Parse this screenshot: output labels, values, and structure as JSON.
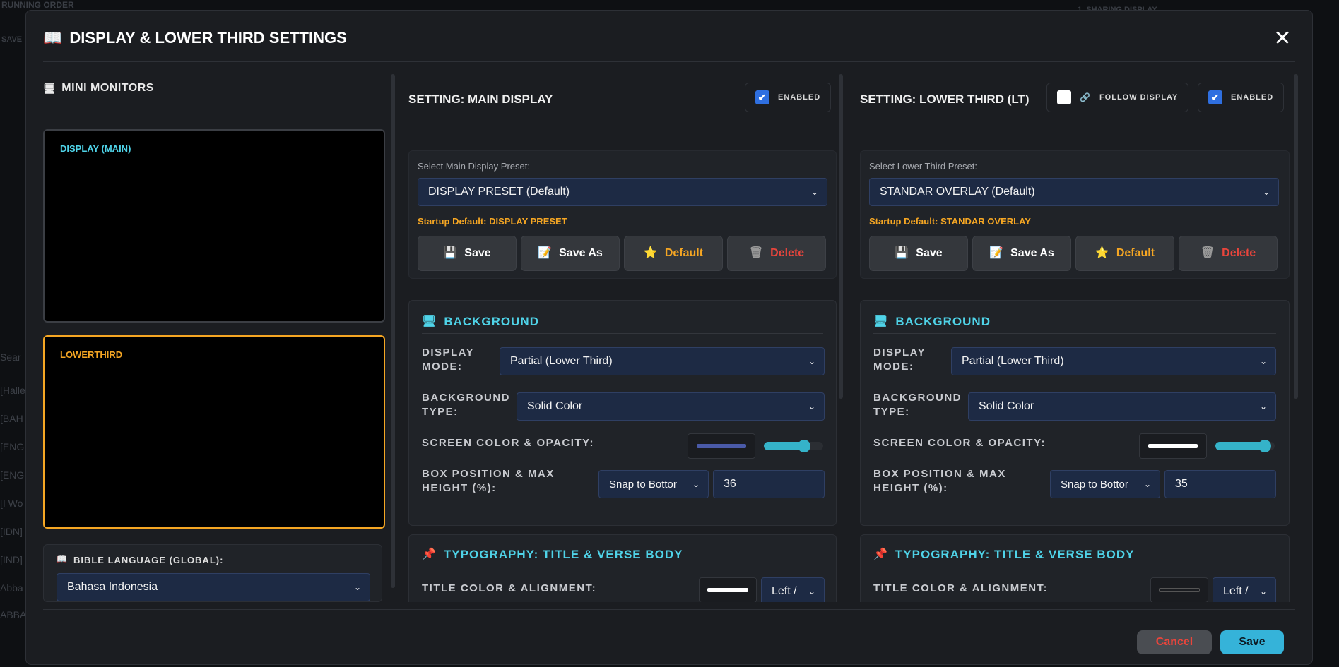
{
  "background": {
    "top_label": "RUNNING ORDER",
    "save_label": "SAVE",
    "right_label": "1. SHARING DISPLAY",
    "search_placeholder": "Sear",
    "list": [
      "[Halle",
      "[BAH",
      "[ENG",
      "[ENG",
      "[I Wo",
      "[IDN]",
      "[IND]",
      "Abba",
      "ABBA"
    ]
  },
  "modal": {
    "title": "DISPLAY & LOWER THIRD SETTINGS",
    "title_icon": "book-icon",
    "close_symbol": "✕"
  },
  "mini_monitors": {
    "title": "MINI MONITORS",
    "monitor_main_label": "DISPLAY (MAIN)",
    "monitor_lt_label": "LOWERTHIRD",
    "colors": {
      "main": "#4fd3e8",
      "lowerthird": "#f5a623"
    }
  },
  "bible_language": {
    "label": "BIBLE LANGUAGE (GLOBAL):",
    "value": "Bahasa Indonesia"
  },
  "main_panel": {
    "title": "SETTING: MAIN DISPLAY",
    "enabled_label": "ENABLED",
    "enabled": true,
    "preset_label": "Select Main Display Preset:",
    "preset_value": "DISPLAY PRESET (Default)",
    "startup_default": "Startup Default: DISPLAY PRESET",
    "buttons": {
      "save": "Save",
      "save_as": "Save As",
      "default": "Default",
      "delete": "Delete"
    },
    "background": {
      "title": "BACKGROUND",
      "display_mode_label": "DISPLAY MODE:",
      "display_mode_value": "Partial (Lower Third)",
      "bg_type_label": "BACKGROUND TYPE:",
      "bg_type_value": "Solid Color",
      "screen_color_label": "SCREEN COLOR & OPACITY:",
      "screen_color": "#4a5aa8",
      "opacity": 0.72,
      "box_position_label": "BOX POSITION & MAX HEIGHT (%):",
      "box_position_value": "Snap to Bottor",
      "max_height": "36"
    },
    "typography": {
      "title": "TYPOGRAPHY: TITLE & VERSE BODY",
      "title_color_label": "TITLE COLOR & ALIGNMENT:",
      "title_color": "#ffffff",
      "alignment_value": "Left /"
    }
  },
  "lt_panel": {
    "title": "SETTING: LOWER THIRD (LT)",
    "follow_label": "FOLLOW DISPLAY",
    "follow": false,
    "enabled_label": "ENABLED",
    "enabled": true,
    "preset_label": "Select Lower Third Preset:",
    "preset_value": "STANDAR OVERLAY (Default)",
    "startup_default": "Startup Default: STANDAR OVERLAY",
    "buttons": {
      "save": "Save",
      "save_as": "Save As",
      "default": "Default",
      "delete": "Delete"
    },
    "background": {
      "title": "BACKGROUND",
      "display_mode_label": "DISPLAY MODE:",
      "display_mode_value": "Partial (Lower Third)",
      "bg_type_label": "BACKGROUND TYPE:",
      "bg_type_value": "Solid Color",
      "screen_color_label": "SCREEN COLOR & OPACITY:",
      "screen_color": "#ffffff",
      "opacity": 0.92,
      "box_position_label": "BOX POSITION & MAX HEIGHT (%):",
      "box_position_value": "Snap to Bottor",
      "max_height": "35"
    },
    "typography": {
      "title": "TYPOGRAPHY: TITLE & VERSE BODY",
      "title_color_label": "TITLE COLOR & ALIGNMENT:",
      "title_color": "#1a1c20",
      "alignment_value": "Left /"
    }
  },
  "footer": {
    "cancel": "Cancel",
    "save": "Save"
  },
  "colors": {
    "accent": "#4fd3e8",
    "warning": "#f5a623",
    "danger": "#e8453c",
    "save_button": "#35b3d9"
  }
}
